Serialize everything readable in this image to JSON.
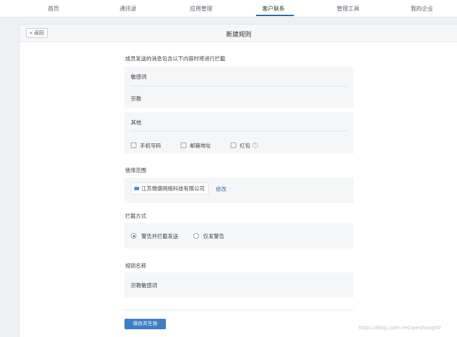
{
  "nav": {
    "items": [
      {
        "label": "首页"
      },
      {
        "label": "通讯录"
      },
      {
        "label": "应用管理"
      },
      {
        "label": "客户联系"
      },
      {
        "label": "管理工具"
      },
      {
        "label": "我的企业"
      }
    ],
    "active_index": 3
  },
  "header": {
    "back_label": "« 返回",
    "title": "新建规则"
  },
  "intercept": {
    "label": "成员发送的消息包含以下内容时将进行拦截",
    "sensitive_words_label": "敏感词",
    "sensitive_words_value": "宗教",
    "other_label": "其他",
    "options": [
      {
        "label": "手机号码",
        "checked": false
      },
      {
        "label": "邮箱地址",
        "checked": false
      },
      {
        "label": "红包",
        "checked": false
      }
    ]
  },
  "scope": {
    "label": "使用范围",
    "org_name": "江苏微盛网络科技有限公司",
    "edit_label": "修改"
  },
  "method": {
    "label": "拦截方式",
    "options": [
      {
        "label": "警告并拦截发送",
        "selected": true
      },
      {
        "label": "仅发警告",
        "selected": false
      }
    ]
  },
  "rule_name": {
    "label": "规则名称",
    "value": "宗教敏感词"
  },
  "save_label": "保存并生效",
  "watermark": "https://blog.csdn.net/weishang00"
}
